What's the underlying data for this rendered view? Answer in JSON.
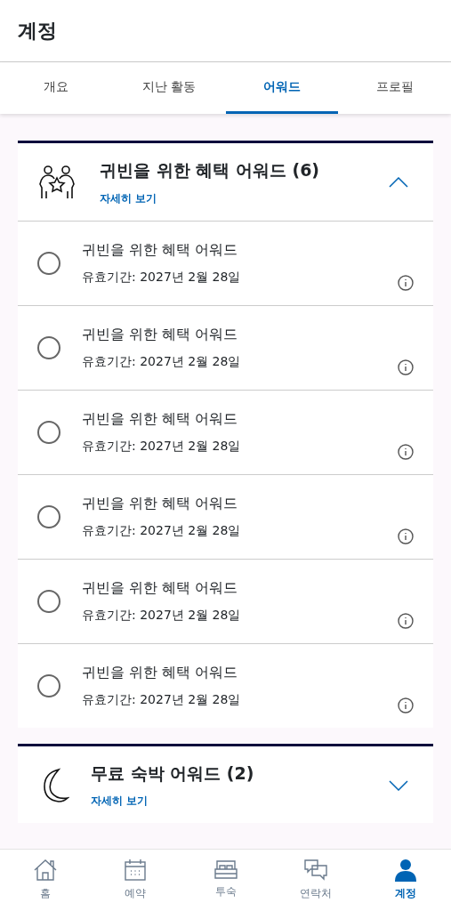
{
  "header": {
    "title": "계정"
  },
  "tabs": [
    {
      "label": "개요",
      "selected": false
    },
    {
      "label": "지난 활동",
      "selected": false
    },
    {
      "label": "어워드",
      "selected": true
    },
    {
      "label": "프로필",
      "selected": false
    }
  ],
  "sections": [
    {
      "title": "귀빈을 위한 혜택 어워드 (6)",
      "link": "자세히 보기",
      "expanded": true,
      "awards": [
        {
          "title": "귀빈을 위한 혜택 어워드",
          "validity": "유효기간: 2027년 2월 28일",
          "selected": false
        },
        {
          "title": "귀빈을 위한 혜택 어워드",
          "validity": "유효기간: 2027년 2월 28일",
          "selected": false
        },
        {
          "title": "귀빈을 위한 혜택 어워드",
          "validity": "유효기간: 2027년 2월 28일",
          "selected": false
        },
        {
          "title": "귀빈을 위한 혜택 어워드",
          "validity": "유효기간: 2027년 2월 28일",
          "selected": false
        },
        {
          "title": "귀빈을 위한 혜택 어워드",
          "validity": "유효기간: 2027년 2월 28일",
          "selected": false
        },
        {
          "title": "귀빈을 위한 혜택 어워드",
          "validity": "유효기간: 2027년 2월 28일",
          "selected": false
        }
      ]
    },
    {
      "title": "무료 숙박 어워드 (2)",
      "link": "자세히 보기",
      "expanded": false
    }
  ],
  "bottom_nav": [
    {
      "label": "홈",
      "selected": false
    },
    {
      "label": "예약",
      "selected": false
    },
    {
      "label": "투숙",
      "selected": false
    },
    {
      "label": "연락처",
      "selected": false
    },
    {
      "label": "계정",
      "selected": true
    }
  ]
}
